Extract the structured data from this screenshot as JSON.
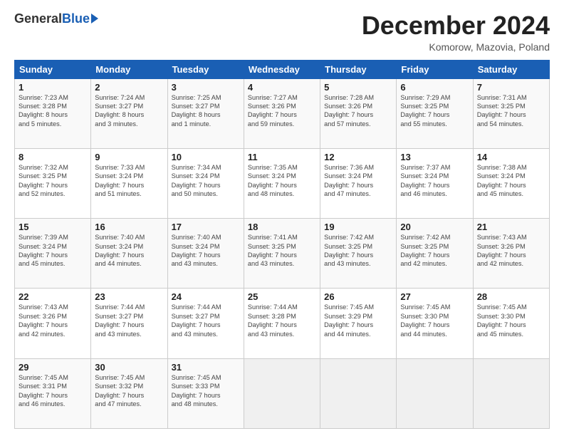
{
  "logo": {
    "general": "General",
    "blue": "Blue"
  },
  "title": {
    "month": "December 2024",
    "location": "Komorow, Mazovia, Poland"
  },
  "days_of_week": [
    "Sunday",
    "Monday",
    "Tuesday",
    "Wednesday",
    "Thursday",
    "Friday",
    "Saturday"
  ],
  "weeks": [
    [
      {
        "day": 1,
        "info": "Sunrise: 7:23 AM\nSunset: 3:28 PM\nDaylight: 8 hours\nand 5 minutes."
      },
      {
        "day": 2,
        "info": "Sunrise: 7:24 AM\nSunset: 3:27 PM\nDaylight: 8 hours\nand 3 minutes."
      },
      {
        "day": 3,
        "info": "Sunrise: 7:25 AM\nSunset: 3:27 PM\nDaylight: 8 hours\nand 1 minute."
      },
      {
        "day": 4,
        "info": "Sunrise: 7:27 AM\nSunset: 3:26 PM\nDaylight: 7 hours\nand 59 minutes."
      },
      {
        "day": 5,
        "info": "Sunrise: 7:28 AM\nSunset: 3:26 PM\nDaylight: 7 hours\nand 57 minutes."
      },
      {
        "day": 6,
        "info": "Sunrise: 7:29 AM\nSunset: 3:25 PM\nDaylight: 7 hours\nand 55 minutes."
      },
      {
        "day": 7,
        "info": "Sunrise: 7:31 AM\nSunset: 3:25 PM\nDaylight: 7 hours\nand 54 minutes."
      }
    ],
    [
      {
        "day": 8,
        "info": "Sunrise: 7:32 AM\nSunset: 3:25 PM\nDaylight: 7 hours\nand 52 minutes."
      },
      {
        "day": 9,
        "info": "Sunrise: 7:33 AM\nSunset: 3:24 PM\nDaylight: 7 hours\nand 51 minutes."
      },
      {
        "day": 10,
        "info": "Sunrise: 7:34 AM\nSunset: 3:24 PM\nDaylight: 7 hours\nand 50 minutes."
      },
      {
        "day": 11,
        "info": "Sunrise: 7:35 AM\nSunset: 3:24 PM\nDaylight: 7 hours\nand 48 minutes."
      },
      {
        "day": 12,
        "info": "Sunrise: 7:36 AM\nSunset: 3:24 PM\nDaylight: 7 hours\nand 47 minutes."
      },
      {
        "day": 13,
        "info": "Sunrise: 7:37 AM\nSunset: 3:24 PM\nDaylight: 7 hours\nand 46 minutes."
      },
      {
        "day": 14,
        "info": "Sunrise: 7:38 AM\nSunset: 3:24 PM\nDaylight: 7 hours\nand 45 minutes."
      }
    ],
    [
      {
        "day": 15,
        "info": "Sunrise: 7:39 AM\nSunset: 3:24 PM\nDaylight: 7 hours\nand 45 minutes."
      },
      {
        "day": 16,
        "info": "Sunrise: 7:40 AM\nSunset: 3:24 PM\nDaylight: 7 hours\nand 44 minutes."
      },
      {
        "day": 17,
        "info": "Sunrise: 7:40 AM\nSunset: 3:24 PM\nDaylight: 7 hours\nand 43 minutes."
      },
      {
        "day": 18,
        "info": "Sunrise: 7:41 AM\nSunset: 3:25 PM\nDaylight: 7 hours\nand 43 minutes."
      },
      {
        "day": 19,
        "info": "Sunrise: 7:42 AM\nSunset: 3:25 PM\nDaylight: 7 hours\nand 43 minutes."
      },
      {
        "day": 20,
        "info": "Sunrise: 7:42 AM\nSunset: 3:25 PM\nDaylight: 7 hours\nand 42 minutes."
      },
      {
        "day": 21,
        "info": "Sunrise: 7:43 AM\nSunset: 3:26 PM\nDaylight: 7 hours\nand 42 minutes."
      }
    ],
    [
      {
        "day": 22,
        "info": "Sunrise: 7:43 AM\nSunset: 3:26 PM\nDaylight: 7 hours\nand 42 minutes."
      },
      {
        "day": 23,
        "info": "Sunrise: 7:44 AM\nSunset: 3:27 PM\nDaylight: 7 hours\nand 43 minutes."
      },
      {
        "day": 24,
        "info": "Sunrise: 7:44 AM\nSunset: 3:27 PM\nDaylight: 7 hours\nand 43 minutes."
      },
      {
        "day": 25,
        "info": "Sunrise: 7:44 AM\nSunset: 3:28 PM\nDaylight: 7 hours\nand 43 minutes."
      },
      {
        "day": 26,
        "info": "Sunrise: 7:45 AM\nSunset: 3:29 PM\nDaylight: 7 hours\nand 44 minutes."
      },
      {
        "day": 27,
        "info": "Sunrise: 7:45 AM\nSunset: 3:30 PM\nDaylight: 7 hours\nand 44 minutes."
      },
      {
        "day": 28,
        "info": "Sunrise: 7:45 AM\nSunset: 3:30 PM\nDaylight: 7 hours\nand 45 minutes."
      }
    ],
    [
      {
        "day": 29,
        "info": "Sunrise: 7:45 AM\nSunset: 3:31 PM\nDaylight: 7 hours\nand 46 minutes."
      },
      {
        "day": 30,
        "info": "Sunrise: 7:45 AM\nSunset: 3:32 PM\nDaylight: 7 hours\nand 47 minutes."
      },
      {
        "day": 31,
        "info": "Sunrise: 7:45 AM\nSunset: 3:33 PM\nDaylight: 7 hours\nand 48 minutes."
      },
      null,
      null,
      null,
      null
    ]
  ]
}
